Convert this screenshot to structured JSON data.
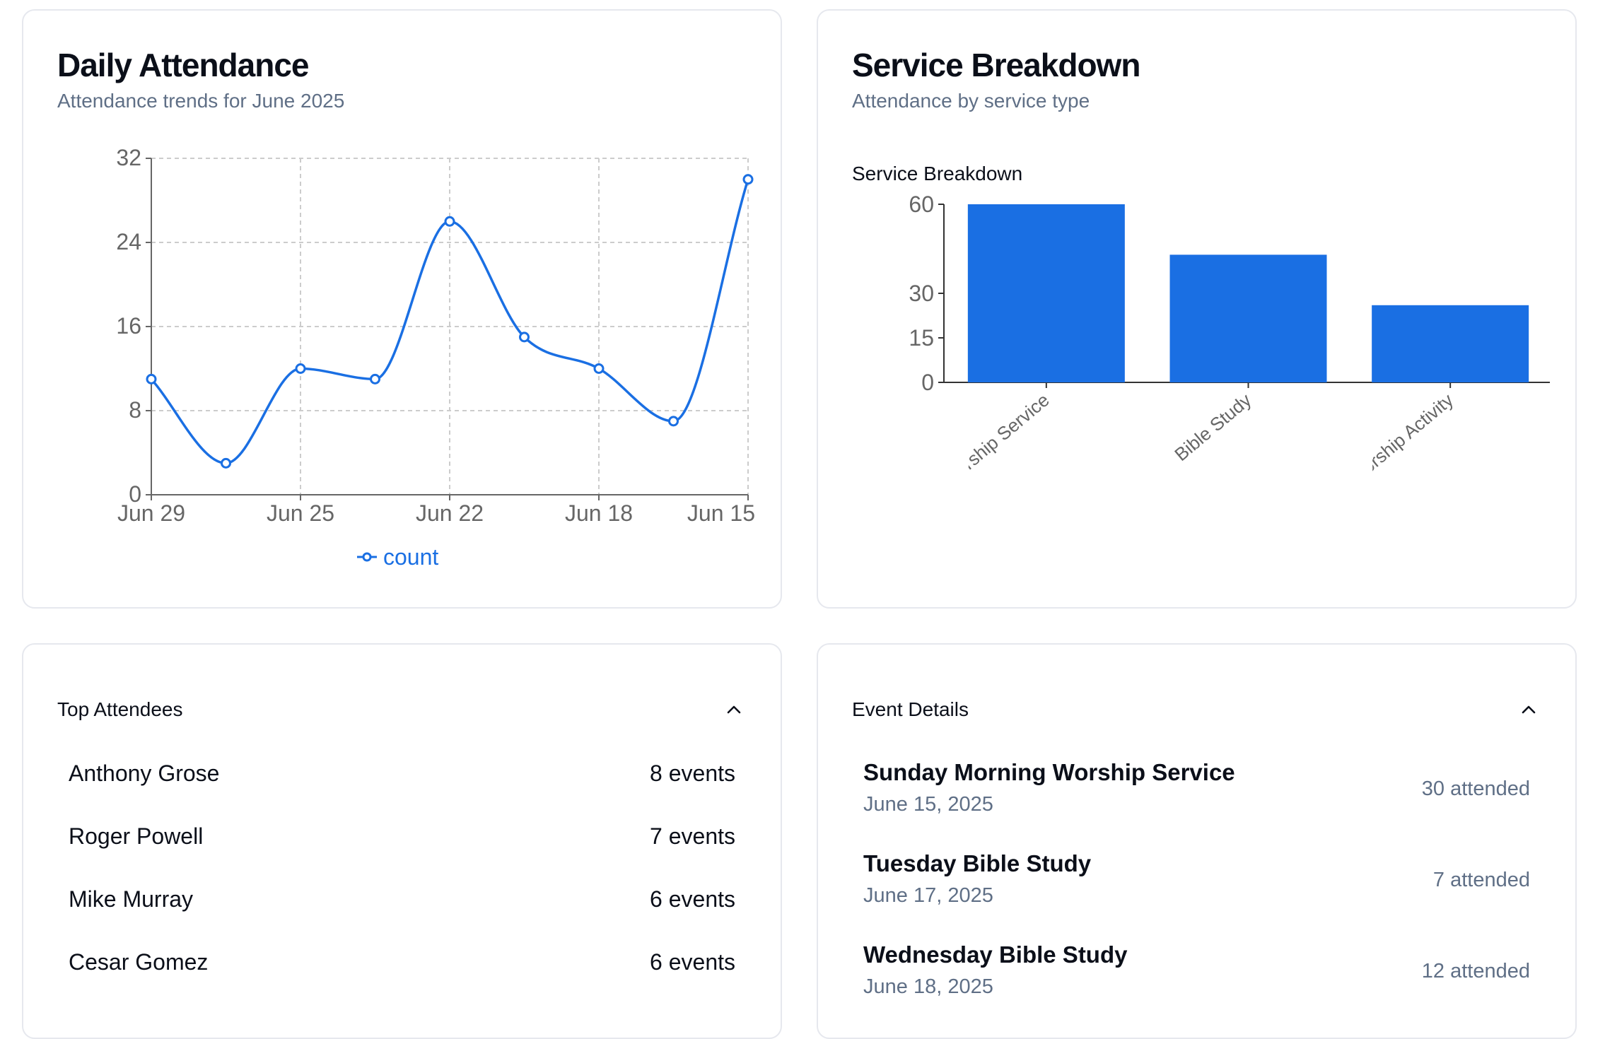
{
  "attendance_card": {
    "title": "Daily Attendance",
    "subtitle": "Attendance trends for June 2025"
  },
  "breakdown_card": {
    "title": "Service Breakdown",
    "subtitle": "Attendance by service type",
    "chart_title": "Service Breakdown"
  },
  "attendees_card": {
    "title": "Top Attendees",
    "items": [
      {
        "name": "Anthony Grose",
        "events": "8 events"
      },
      {
        "name": "Roger Powell",
        "events": "7 events"
      },
      {
        "name": "Mike Murray",
        "events": "6 events"
      },
      {
        "name": "Cesar Gomez",
        "events": "6 events"
      }
    ]
  },
  "events_card": {
    "title": "Event Details",
    "items": [
      {
        "name": "Sunday Morning Worship Service",
        "date": "June 15, 2025",
        "attended": "30 attended"
      },
      {
        "name": "Tuesday Bible Study",
        "date": "June 17, 2025",
        "attended": "7 attended"
      },
      {
        "name": "Wednesday Bible Study",
        "date": "June 18, 2025",
        "attended": "12 attended"
      }
    ]
  },
  "colors": {
    "accent": "#1a6fe3",
    "grid": "#cccccc",
    "muted_text": "#5f6f86"
  },
  "icons": {
    "collapse": "chevron-up-icon"
  },
  "chart_data": [
    {
      "type": "line",
      "title": "",
      "x": [
        "Jun 29",
        "",
        "Jun 25",
        "",
        "Jun 22",
        "",
        "Jun 18",
        "",
        "Jun 15"
      ],
      "x_tick_labels": [
        "Jun 29",
        "Jun 25",
        "Jun 22",
        "Jun 18",
        "Jun 15"
      ],
      "series": [
        {
          "name": "count",
          "values": [
            11,
            3,
            12,
            11,
            26,
            15,
            12,
            7,
            30
          ]
        }
      ],
      "ylim": [
        0,
        32
      ],
      "y_ticks": [
        0,
        8,
        16,
        24,
        32
      ],
      "grid": true,
      "legend": "bottom"
    },
    {
      "type": "bar",
      "title": "Service Breakdown",
      "categories": [
        "Worship Service",
        "Bible Study",
        "Worship Activity"
      ],
      "values": [
        60,
        43,
        26
      ],
      "ylim": [
        0,
        60
      ],
      "y_ticks": [
        0,
        15,
        30,
        60
      ],
      "grid": false
    }
  ]
}
